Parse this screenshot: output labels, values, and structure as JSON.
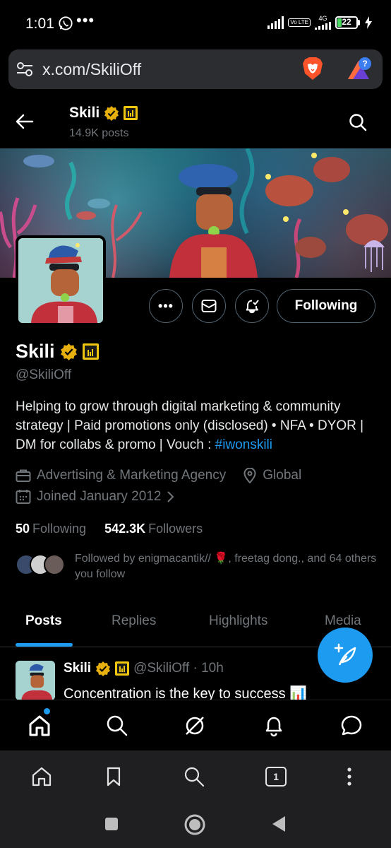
{
  "status_bar": {
    "time": "1:01",
    "more": "•••",
    "volte": "Vo LTE",
    "network": "4G",
    "battery": "22"
  },
  "browser": {
    "url": "x.com/SkiliOff",
    "brave_icon": "brave-lion-icon",
    "rewards_icon": "brave-rewards-icon",
    "rewards_badge": "?"
  },
  "header": {
    "name": "Skili",
    "posts_count": "14.9K posts"
  },
  "profile": {
    "name": "Skili",
    "handle": "@SkiliOff",
    "bio_text": "Helping to grow through digital marketing & community strategy | Paid promotions only (disclosed) • NFA • DYOR | DM for collabs & promo | Vouch : ",
    "bio_hashtag": "#iwonskili",
    "category": "Advertising & Marketing Agency",
    "location": "Global",
    "joined": "Joined January 2012",
    "following_count": "50",
    "following_label": "Following",
    "followers_count": "542.3K",
    "followers_label": "Followers",
    "followed_by": "Followed by enigmacantik// 🌹, freetag dong., and 64 others you follow",
    "follow_button": "Following",
    "more_button": "•••"
  },
  "tabs": [
    {
      "label": "Posts",
      "active": true
    },
    {
      "label": "Replies",
      "active": false
    },
    {
      "label": "Highlights",
      "active": false
    },
    {
      "label": "Media",
      "active": false
    }
  ],
  "post": {
    "name": "Skili",
    "handle_time": "@SkiliOff · 10h",
    "text": "Concentration is the key to success 📊"
  },
  "browser_toolbar": {
    "tab_count": "1"
  },
  "colors": {
    "accent": "#1d9bf0",
    "verified_gold": "#e8b00f",
    "background": "#000000",
    "muted_text": "#71767b"
  }
}
